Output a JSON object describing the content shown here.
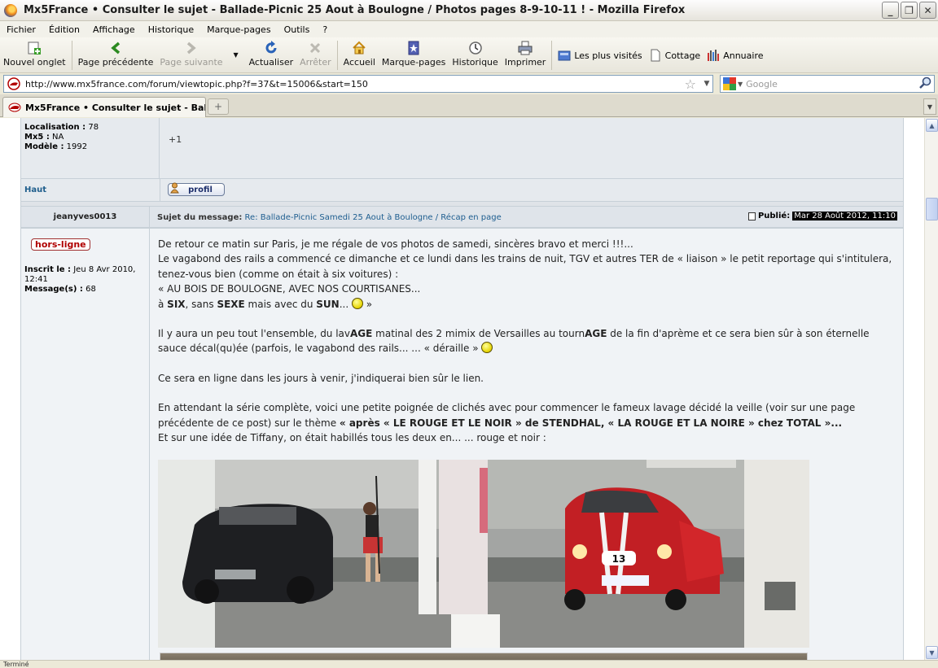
{
  "window": {
    "title": "Mx5France • Consulter le sujet - Ballade-Picnic 25 Aout à Boulogne / Photos pages 8-9-10-11 ! - Mozilla Firefox",
    "minimize": "_",
    "maximize": "❐",
    "close": "✕"
  },
  "menu": [
    "Fichier",
    "Édition",
    "Affichage",
    "Historique",
    "Marque-pages",
    "Outils",
    "?"
  ],
  "toolbar": {
    "new_tab": "Nouvel onglet",
    "back": "Page précédente",
    "forward": "Page suivante",
    "reload": "Actualiser",
    "stop": "Arrêter",
    "home": "Accueil",
    "bookmarks": "Marque-pages",
    "history": "Historique",
    "print": "Imprimer",
    "bm_most_visited": "Les plus visités",
    "bm_cottage": "Cottage",
    "bm_annuaire": "Annuaire"
  },
  "urlbar": {
    "url": "http://www.mx5france.com/forum/viewtopic.php?f=37&t=15006&start=150",
    "search_placeholder": "Google"
  },
  "tab": {
    "label": "Mx5France • Consulter le sujet - Ball...",
    "new_tab_symbol": "+"
  },
  "prev_post": {
    "localisation_label": "Localisation :",
    "localisation": "78",
    "mx5_label": "Mx5 :",
    "mx5": "NA",
    "modele_label": "Modèle :",
    "modele": "1992",
    "body": "+1",
    "haut": "Haut",
    "profil": "profil"
  },
  "post": {
    "author": "jeanyves0013",
    "subject_label": "Sujet du message:",
    "subject": "Re: Ballade-Picnic Samedi 25 Aout à Boulogne / Récap en page",
    "posted_label": "Publié:",
    "posted_date": "Mar 28 Août 2012, 11:10",
    "status": "hors-ligne",
    "inscrit_label": "Inscrit le :",
    "inscrit": "Jeu 8 Avr 2010, 12:41",
    "messages_label": "Message(s) :",
    "messages": "68",
    "p1": "De retour ce matin sur Paris, je me régale de vos photos de samedi, sincères bravo et merci !!!...",
    "p2": "Le vagabond des rails a commencé ce dimanche et ce lundi dans les trains de nuit, TGV et autres TER de « liaison » le petit reportage qui s'intitulera, tenez-vous bien (comme on était à six voitures) :",
    "p3": "« AU BOIS DE BOULOGNE, AVEC NOS COURTISANES...",
    "p4a": "à ",
    "p4b": "SIX",
    "p4c": ", sans ",
    "p4d": "SEXE",
    "p4e": " mais avec du ",
    "p4f": "SUN",
    "p4g": "... ",
    "p4h": " »",
    "p5a": "Il y aura un peu tout l'ensemble, du lav",
    "p5b": "AGE",
    "p5c": " matinal des 2 mimix de Versailles au tourn",
    "p5d": "AGE",
    "p5e": " de la fin d'aprème et ce sera bien sûr à son éternelle sauce décal(qu)ée (parfois, le vagabond des rails... ... « déraille » ",
    "p6": "Ce sera en ligne dans les jours à venir, j'indiquerai bien sûr le lien.",
    "p7a": "En attendant la série complète, voici une petite poignée de clichés avec pour commencer le fameux lavage décidé la veille (voir sur une page précédente de ce post) sur le thème ",
    "p7b": "« après « LE ROUGE ET LE NOIR » de STENDHAL, « LA ROUGE ET LA NOIRE » chez TOTAL »...",
    "p8": "Et sur une idée de Tiffany, on était habillés tous les deux en... ... rouge et noir :",
    "plate_number": "13"
  },
  "status_bar": "Terminé"
}
